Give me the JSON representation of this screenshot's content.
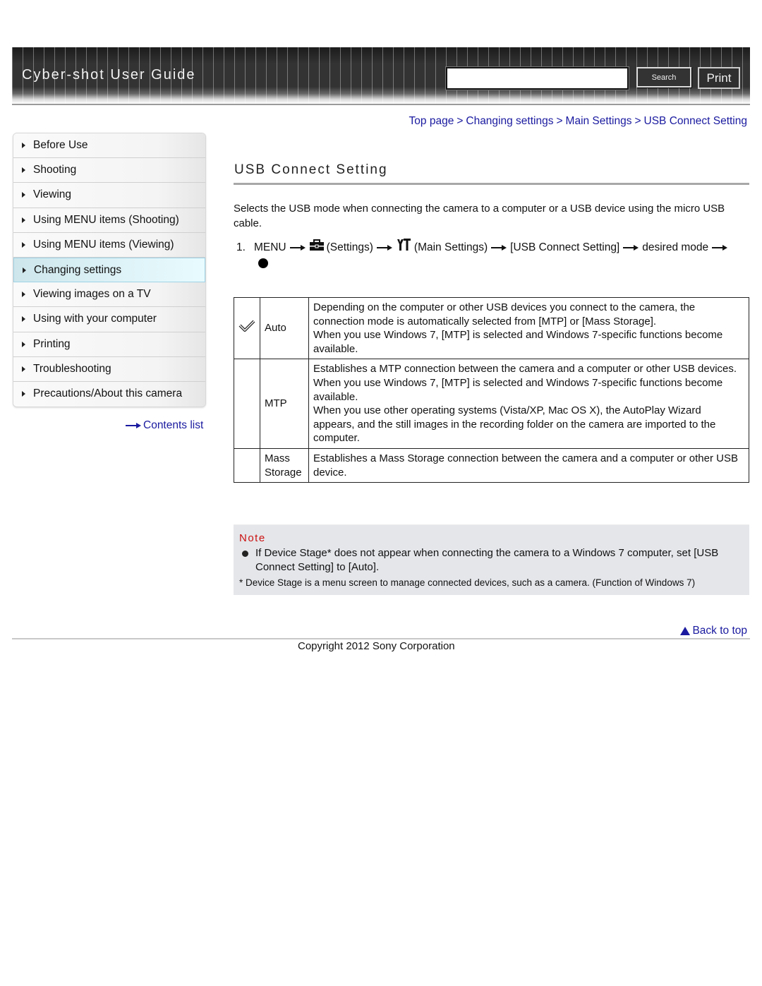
{
  "header": {
    "title": "Cyber-shot User Guide",
    "search_value": "",
    "search_placeholder": "",
    "search_label": "Search",
    "print_label": "Print"
  },
  "breadcrumb": {
    "items": [
      "Top page",
      "Changing settings",
      "Main Settings",
      "USB Connect Setting"
    ],
    "separator": ">"
  },
  "sidebar": {
    "items": [
      {
        "label": "Before Use",
        "active": false
      },
      {
        "label": "Shooting",
        "active": false
      },
      {
        "label": "Viewing",
        "active": false
      },
      {
        "label": "Using MENU items (Shooting)",
        "active": false
      },
      {
        "label": "Using MENU items (Viewing)",
        "active": false
      },
      {
        "label": "Changing settings",
        "active": true
      },
      {
        "label": "Viewing images on a TV",
        "active": false
      },
      {
        "label": "Using with your computer",
        "active": false
      },
      {
        "label": "Printing",
        "active": false
      },
      {
        "label": "Troubleshooting",
        "active": false
      },
      {
        "label": "Precautions/About this camera",
        "active": false
      }
    ],
    "contents_link": "Contents list"
  },
  "main": {
    "title": "USB Connect Setting",
    "intro": "Selects the USB mode when connecting the camera to a computer or a USB device using the micro USB cable.",
    "step": {
      "number": "1.",
      "menu": "MENU",
      "settings": "(Settings)",
      "main_settings": "(Main Settings)",
      "item": "[USB Connect Setting]",
      "desired": "desired mode"
    },
    "table": [
      {
        "icon": "checkmark-icon",
        "mode": "Auto",
        "description": [
          "Depending on the computer or other USB devices you connect to the camera, the connection mode is automatically selected from [MTP] or [Mass Storage].",
          "When you use Windows 7, [MTP] is selected and Windows 7-specific functions become available."
        ]
      },
      {
        "icon": "",
        "mode": "MTP",
        "description": [
          "Establishes a MTP connection between the camera and a computer or other USB devices.",
          "When you use Windows 7, [MTP] is selected and Windows 7-specific functions become available.",
          "When you use other operating systems (Vista/XP, Mac OS X), the AutoPlay Wizard appears, and the still images in the recording folder on the camera are imported to the computer."
        ]
      },
      {
        "icon": "",
        "mode": "Mass Storage",
        "description": [
          "Establishes a Mass Storage connection between the camera and a computer or other USB device."
        ]
      }
    ],
    "note": {
      "title": "Note",
      "bullet": "If Device Stage* does not appear when connecting the camera to a Windows 7 computer, set [USB Connect Setting] to [Auto].",
      "footnote": "* Device Stage is a menu screen to manage connected devices, such as a camera. (Function of Windows 7)"
    }
  },
  "footer": {
    "back_to_top": "Back to top",
    "copyright": "Copyright 2012 Sony Corporation"
  },
  "colors": {
    "link": "#1a1aa0",
    "note_title": "#cc1111",
    "note_bg": "#e4e6ea",
    "active_item": "#dff4f8"
  }
}
